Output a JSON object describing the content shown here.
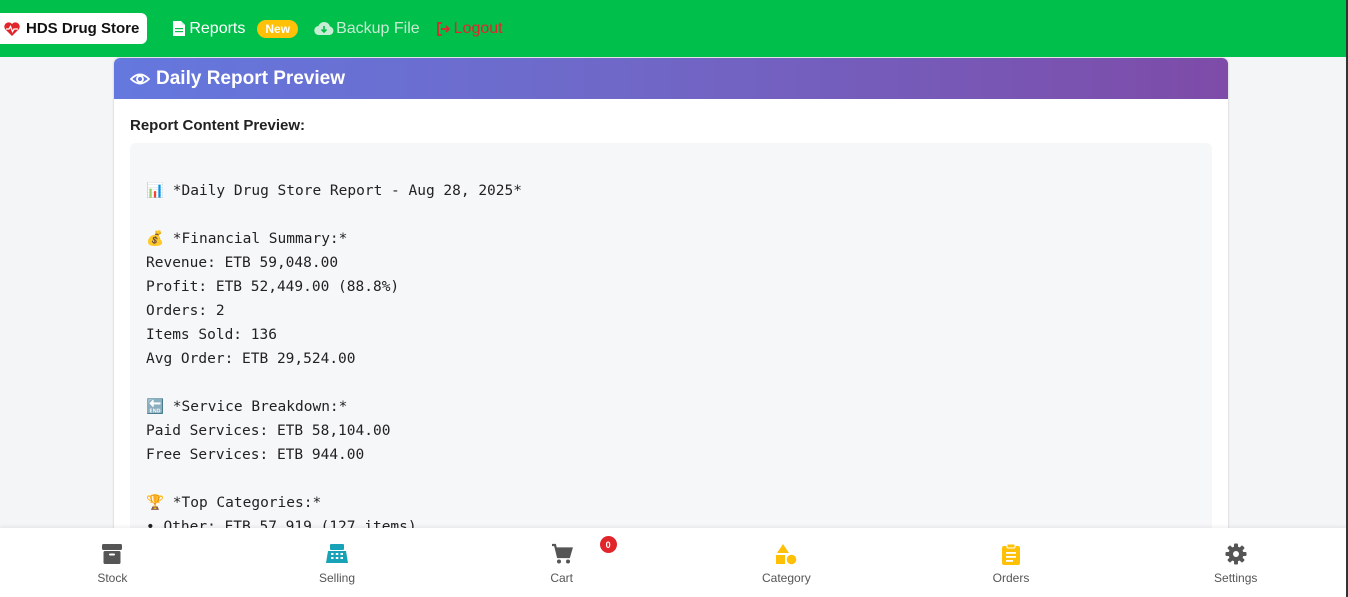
{
  "topbar": {
    "brand": "HDS Drug Store",
    "reports": "Reports",
    "new_badge": "New",
    "backup": "Backup File",
    "logout": "Logout"
  },
  "card": {
    "title": "Daily Report Preview",
    "preview_label": "Report Content Preview:",
    "report_text": "📊 *Daily Drug Store Report - Aug 28, 2025*\n\n💰 *Financial Summary:*\nRevenue: ETB 59,048.00\nProfit: ETB 52,449.00 (88.8%)\nOrders: 2\nItems Sold: 136\nAvg Order: ETB 29,524.00\n\n🔚 *Service Breakdown:*\nPaid Services: ETB 58,104.00\nFree Services: ETB 944.00\n\n🏆 *Top Categories:*\n• Other: ETB 57,919 (127 items)"
  },
  "bottom_nav": {
    "stock": "Stock",
    "selling": "Selling",
    "cart": "Cart",
    "cart_count": "0",
    "category": "Category",
    "orders": "Orders",
    "settings": "Settings"
  },
  "colors": {
    "topbar": "#00bf4a",
    "header_gradient_start": "#6478de",
    "header_gradient_end": "#7e4ba8",
    "badge_new": "#ffc107",
    "logout": "#e0262b",
    "selling_icon": "#17a2b8",
    "category_icon": "#ffc107",
    "orders_icon": "#ffc107"
  }
}
